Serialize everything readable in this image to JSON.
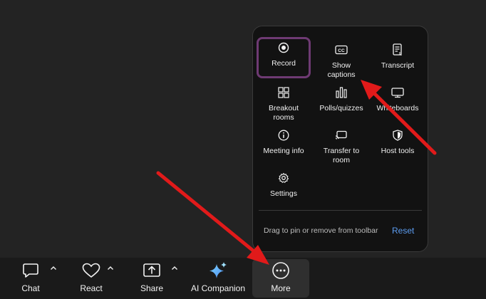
{
  "colors": {
    "background": "#232323",
    "menu_bg": "#121212",
    "selected_border": "#6e3a73",
    "reset_link": "#5b9cf0",
    "annotation_arrow": "#e11a1a"
  },
  "menu": {
    "items": [
      {
        "label": "Record",
        "icon": "record-icon",
        "selected": true
      },
      {
        "label": "Show\ncaptions",
        "icon": "cc-icon"
      },
      {
        "label": "Transcript",
        "icon": "transcript-icon"
      },
      {
        "label": "Breakout\nrooms",
        "icon": "breakout-rooms-icon"
      },
      {
        "label": "Polls/quizzes",
        "icon": "polls-icon"
      },
      {
        "label": "Whiteboards",
        "icon": "whiteboard-icon"
      },
      {
        "label": "Meeting info",
        "icon": "info-icon"
      },
      {
        "label": "Transfer to\nroom",
        "icon": "transfer-icon"
      },
      {
        "label": "Host tools",
        "icon": "shield-icon"
      },
      {
        "label": "Settings",
        "icon": "gear-icon"
      }
    ],
    "footer_text": "Drag to pin or remove from toolbar",
    "reset_label": "Reset"
  },
  "toolbar": {
    "chat_label": "Chat",
    "react_label": "React",
    "share_label": "Share",
    "ai_label": "AI Companion",
    "more_label": "More"
  }
}
